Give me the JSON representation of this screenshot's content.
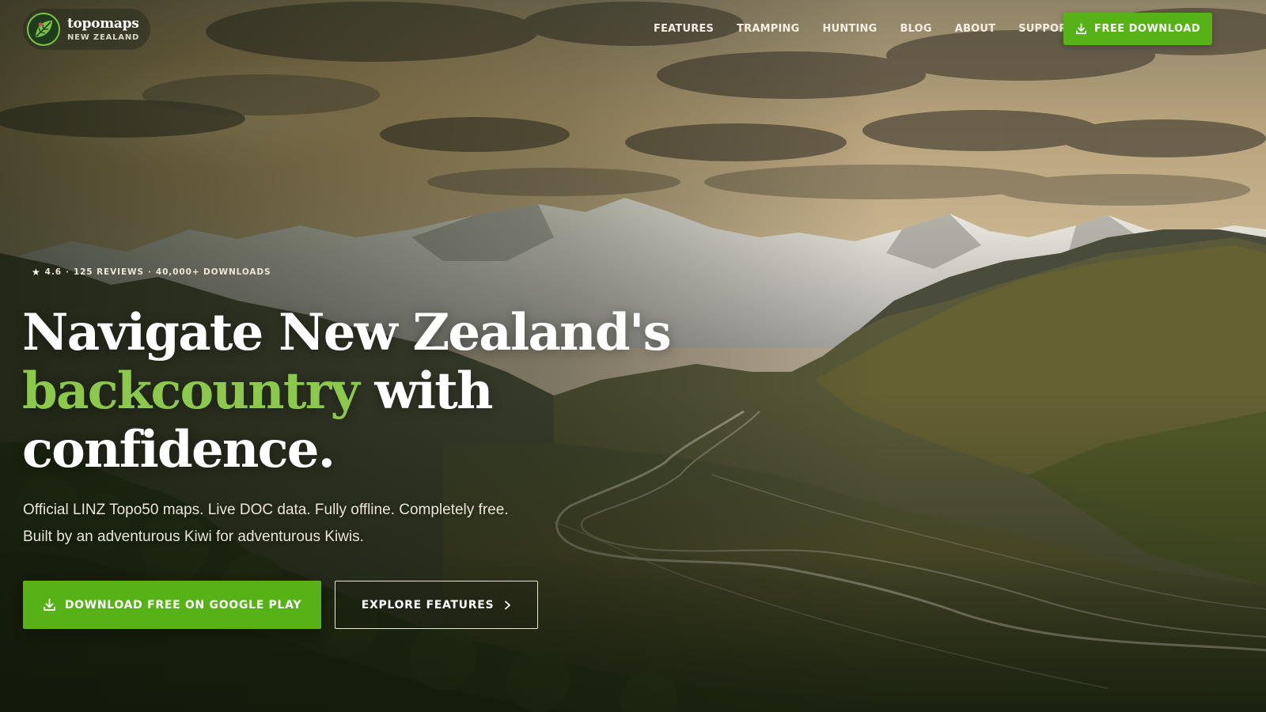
{
  "nav": {
    "logo": {
      "name": "topomaps",
      "tagline": "NEW ZEALAND",
      "icon": "leaf-map-icon"
    },
    "links": [
      {
        "label": "FEATURES"
      },
      {
        "label": "TRAMPING"
      },
      {
        "label": "HUNTING"
      },
      {
        "label": "BLOG"
      },
      {
        "label": "ABOUT"
      },
      {
        "label": "SUPPORT"
      }
    ],
    "cta": {
      "label": "FREE DOWNLOAD",
      "icon": "download-icon"
    }
  },
  "hero": {
    "rating": {
      "score": "4.6",
      "reviews": "125 REVIEWS",
      "downloads": "40,000+ DOWNLOADS",
      "separator": "·"
    },
    "headline": {
      "part1": "Navigate New Zealand's ",
      "accent": "backcountry",
      "part2": " with confidence."
    },
    "subtext": "Official LINZ Topo50 maps. Live DOC data. Fully offline. Completely free. Built by an adventurous Kiwi for adventurous Kiwis.",
    "primary_button": {
      "label": "DOWNLOAD FREE ON GOOGLE PLAY",
      "icon": "download-icon"
    },
    "secondary_button": {
      "label": "EXPLORE FEATURES",
      "icon": "chevron-right-icon"
    }
  },
  "colors": {
    "accent_green": "#56b217",
    "headline_accent": "#8cc84b",
    "text_light": "#ebe6d8"
  }
}
